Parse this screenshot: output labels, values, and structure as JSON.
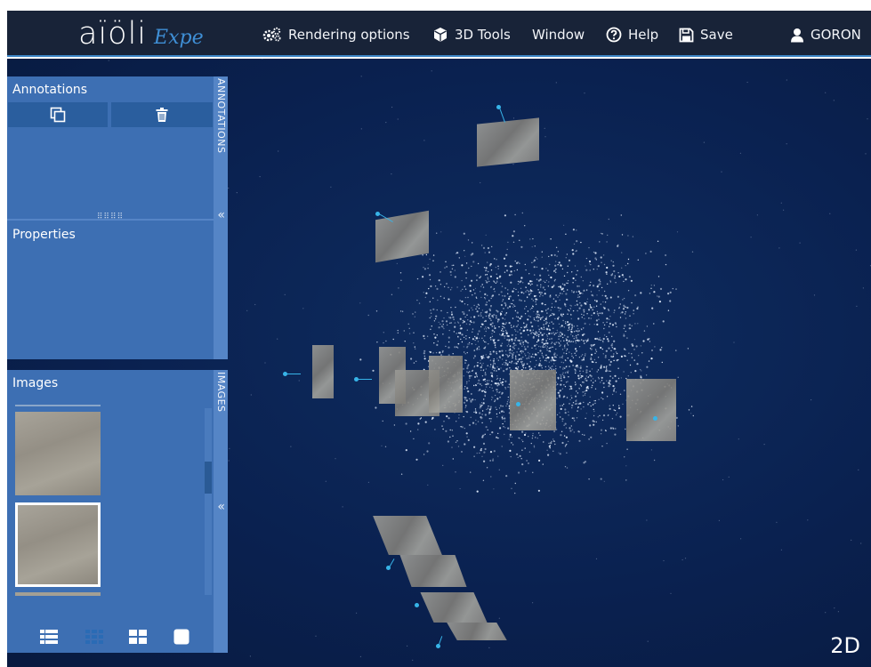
{
  "app": {
    "logo_main": "aïöli",
    "logo_sub": "Expe"
  },
  "menu": {
    "rendering_options": "Rendering options",
    "tools_3d": "3D Tools",
    "window": "Window",
    "help": "Help",
    "save": "Save",
    "user": "GORON"
  },
  "annotations_panel": {
    "title": "Annotations",
    "rail_label": "ANNOTATIONS",
    "properties_title": "Properties",
    "collapse_glyph": "«"
  },
  "images_panel": {
    "title": "Images",
    "rail_label": "IMAGES",
    "collapse_glyph": "«"
  },
  "viewer": {
    "mode_label": "2D"
  },
  "colors": {
    "navbar": "#182338",
    "accent": "#3f8fd6",
    "panel": "#3d6fb3",
    "viewer_bg": "#0a2150",
    "camera": "#37b4e8"
  },
  "icons": [
    "gears-icon",
    "cube-icon",
    "question-circle-icon",
    "floppy-disk-icon",
    "user-icon",
    "copy-icon",
    "trash-icon",
    "list-view-icon",
    "grid-small-icon",
    "grid-large-icon",
    "single-view-icon"
  ]
}
